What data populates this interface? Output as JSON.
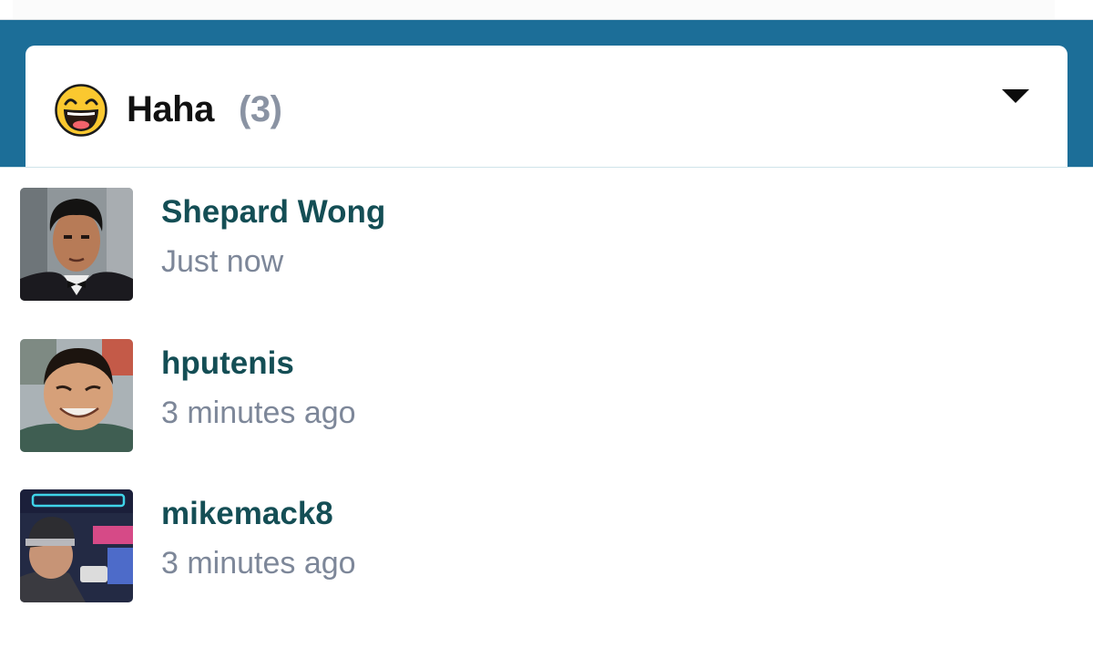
{
  "header": {
    "reaction_label": "Haha",
    "reaction_count": "(3)",
    "emoji_icon": "laughing-face-icon",
    "toggle_icon": "caret-down-icon"
  },
  "colors": {
    "band": "#1c6e98",
    "name": "#144e55",
    "muted": "#7d8799",
    "count": "#8a93a3"
  },
  "users": [
    {
      "name": "Shepard Wong",
      "time": "Just now"
    },
    {
      "name": "hputenis",
      "time": "3 minutes ago"
    },
    {
      "name": "mikemack8",
      "time": "3 minutes ago"
    }
  ]
}
